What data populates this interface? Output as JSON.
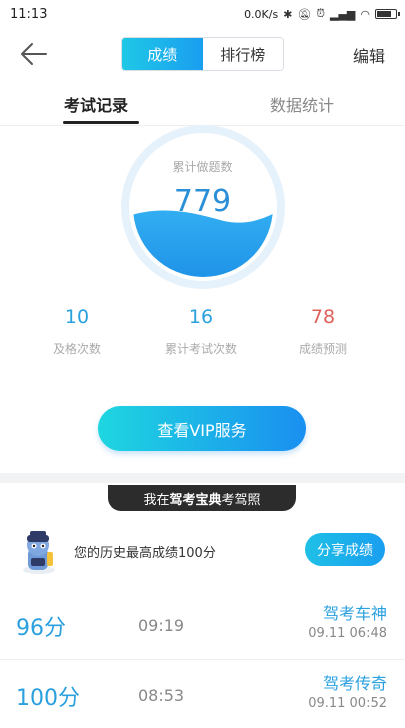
{
  "status": {
    "time": "11:13",
    "net": "0.0K/s"
  },
  "nav": {
    "seg_active": "成绩",
    "seg_inactive": "排行榜",
    "edit": "编辑"
  },
  "tabs": {
    "tab1": "考试记录",
    "tab2": "数据统计"
  },
  "gauge": {
    "label": "累计做题数",
    "value": "779",
    "fill_fraction": 0.42
  },
  "stats": [
    {
      "value": "10",
      "label": "及格次数"
    },
    {
      "value": "16",
      "label": "累计考试次数"
    },
    {
      "value": "78",
      "label": "成绩预测"
    }
  ],
  "vip_button": "查看VIP服务",
  "banner": {
    "prefix": "我在",
    "brand": "驾考宝典",
    "suffix": "考驾照"
  },
  "best": {
    "text": "您的历史最高成绩100分",
    "share": "分享成绩"
  },
  "records": [
    {
      "score": "96分",
      "duration": "09:19",
      "title": "驾考车神",
      "date": "09.11 06:48"
    },
    {
      "score": "100分",
      "duration": "08:53",
      "title": "驾考传奇",
      "date": "09.11 00:52"
    }
  ],
  "colors": {
    "accent": "#2aa0df",
    "danger": "#e0605a"
  }
}
